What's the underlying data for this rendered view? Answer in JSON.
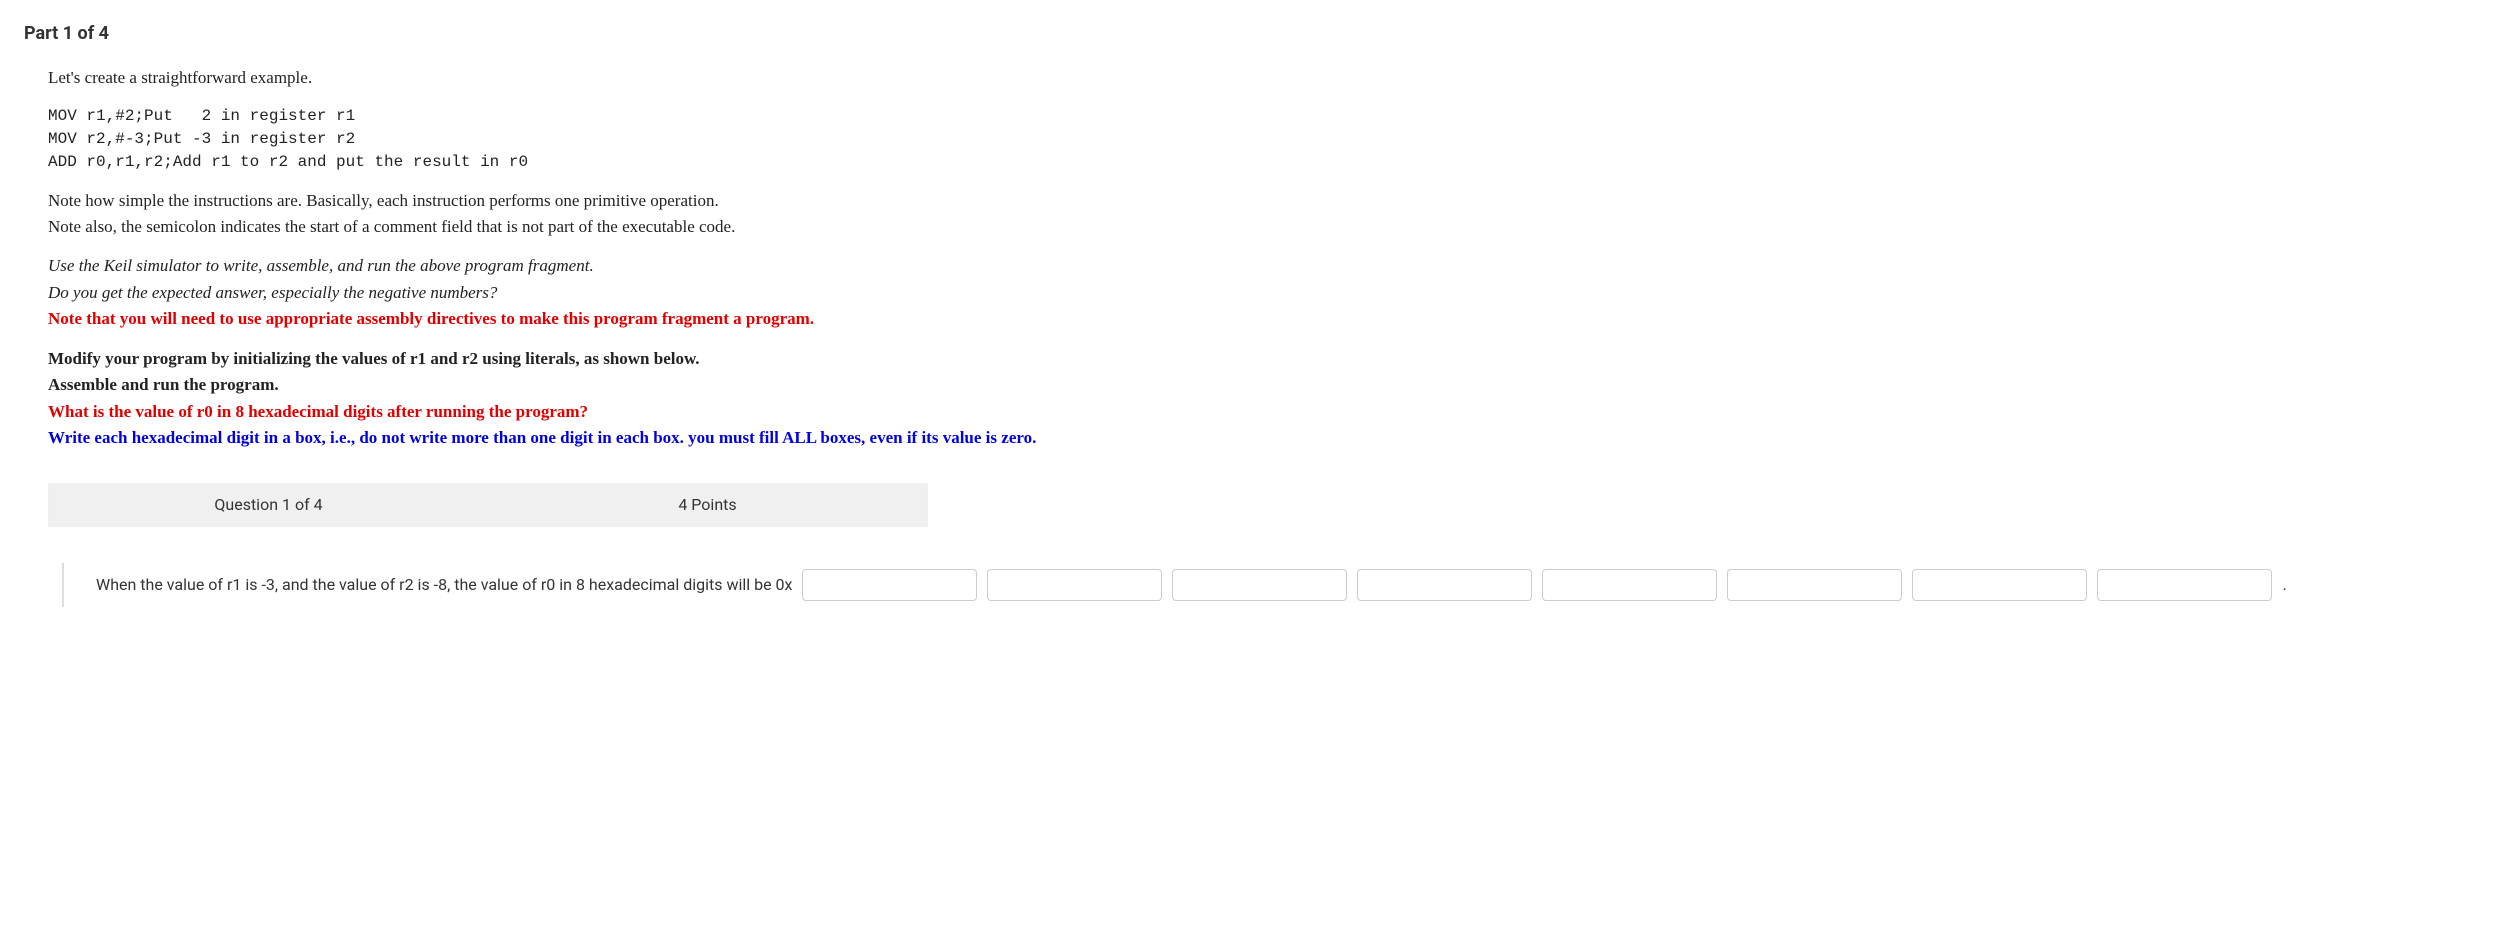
{
  "part_header": "Part 1 of 4",
  "intro": "Let's create a straightforward example.",
  "code": "MOV r1,#2;Put   2 in register r1\nMOV r2,#-3;Put -3 in register r2\nADD r0,r1,r2;Add r1 to r2 and put the result in r0",
  "note1": "Note how simple the instructions are. Basically, each instruction performs one primitive operation.",
  "note2": "Note also, the semicolon indicates the start of a comment field that is not part of the executable code.",
  "italic1": "Use the Keil simulator to write, assemble, and run the above program fragment.",
  "italic2": "Do you get the expected answer, especially the negative numbers?",
  "red_note": "Note that you will need to use appropriate assembly directives to make this program fragment a program.",
  "modify1": "Modify your program by initializing the values of r1 and r2 using literals, as shown below.",
  "modify2": "Assemble and run the program.",
  "red_question": "What is the value of r0 in 8 hexadecimal digits after running the program?",
  "blue_instruction": "Write each hexadecimal digit in a box, i.e., do not write more than one digit in each box. you must fill ALL boxes, even if its value is zero.",
  "question_bar": {
    "label": "Question 1 of 4",
    "points": "4 Points"
  },
  "answer_prompt": "When the value of r1 is -3, and the value of r2 is -8, the value of r0 in 8 hexadecimal digits will be 0x",
  "trailing_dot": ".",
  "inputs": [
    "",
    "",
    "",
    "",
    "",
    "",
    "",
    ""
  ]
}
